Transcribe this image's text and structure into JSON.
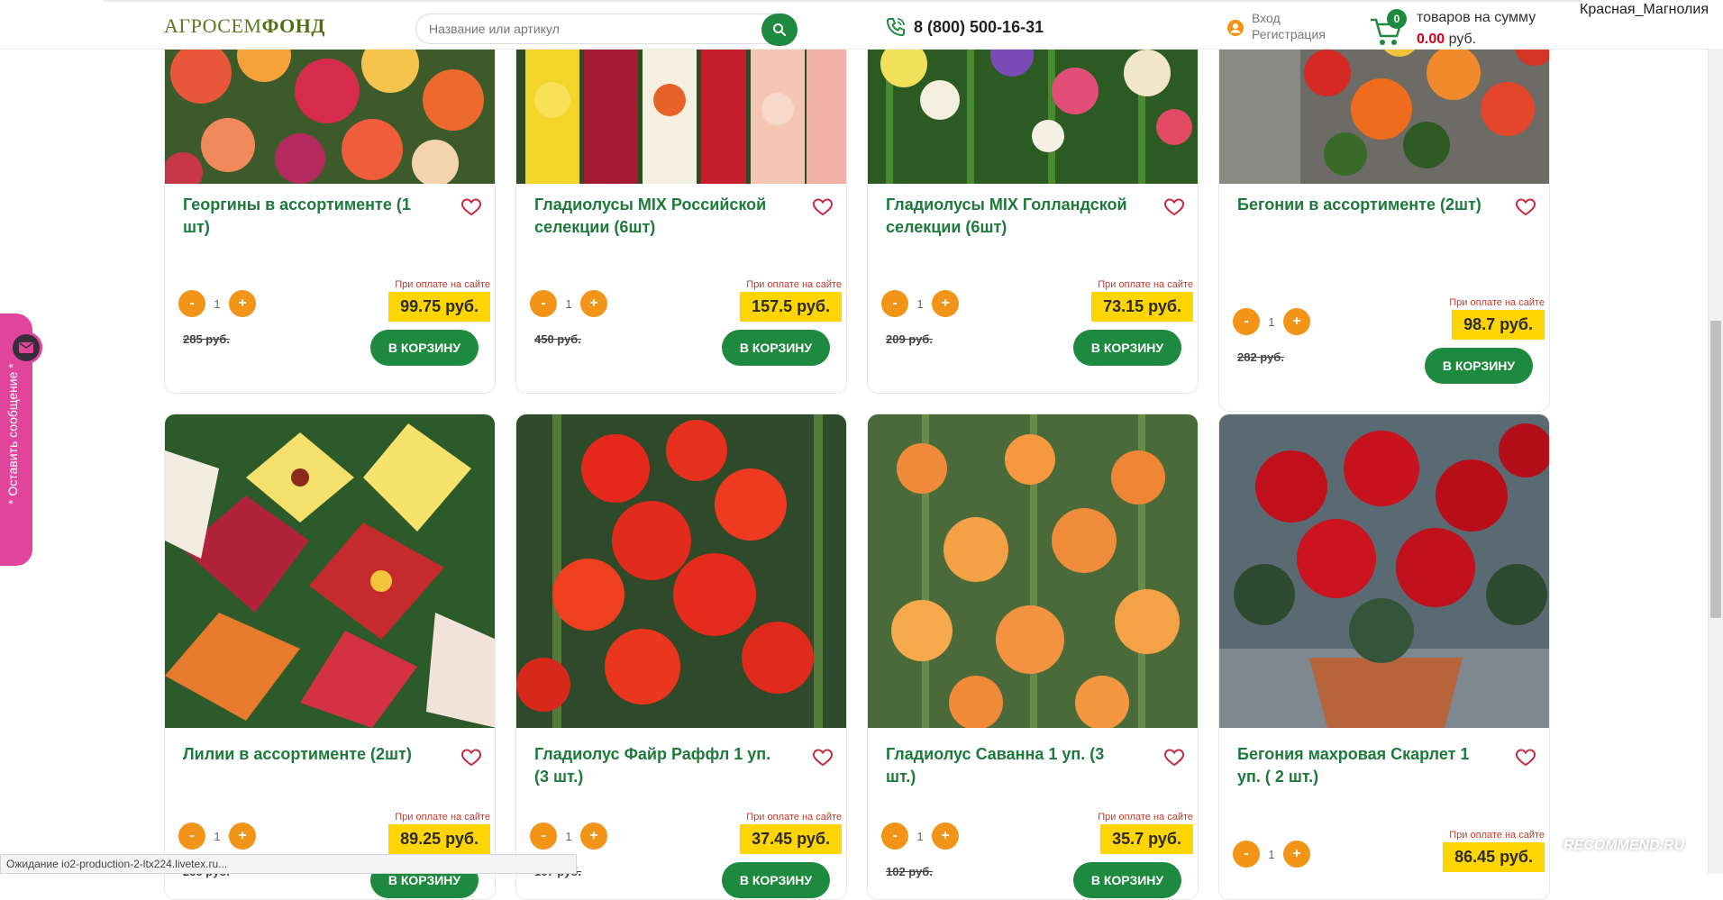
{
  "header": {
    "logo_part1": "АГРОСЕМ",
    "logo_part2": "ФОНД",
    "search_placeholder": "Название или артикул",
    "phone": "8 (800) 500-16-31",
    "login": "Вход",
    "register": "Регистрация",
    "cart_count": "0",
    "cart_text": "товаров на сумму",
    "cart_sum": "0.00",
    "cart_currency": "руб.",
    "username": "Красная_Магнолия"
  },
  "feedback": {
    "label": "* Оставить сообщение *"
  },
  "common": {
    "price_note": "При оплате на сайте",
    "add_to_cart": "В КОРЗИНУ",
    "minus": "-",
    "plus": "+"
  },
  "products_row1": [
    {
      "title": "Георгины в ассортименте (1 шт)",
      "qty": "1",
      "price": "99.75 руб.",
      "old_price": "285 руб."
    },
    {
      "title": "Гладиолусы MIX Российской селекции (6шт)",
      "qty": "1",
      "price": "157.5 руб.",
      "old_price": "450 руб."
    },
    {
      "title": "Гладиолусы MIX Голландской селекции (6шт)",
      "qty": "1",
      "price": "73.15 руб.",
      "old_price": "209 руб."
    },
    {
      "title": "Бегонии в ассортименте (2шт)",
      "qty": "1",
      "price": "98.7 руб.",
      "old_price": "282 руб."
    }
  ],
  "products_row2": [
    {
      "title": "Лилии в ассортименте (2шт)",
      "qty": "1",
      "price": "89.25 руб.",
      "old_price": "255 руб."
    },
    {
      "title": "Гладиолус Файр Раффл 1 уп. (3 шт.)",
      "qty": "1",
      "price": "37.45 руб.",
      "old_price": "107 руб."
    },
    {
      "title": "Гладиолус Саванна 1 уп. (3 шт.)",
      "qty": "1",
      "price": "35.7 руб.",
      "old_price": "102 руб."
    },
    {
      "title": "Бегония махровая Скарлет 1 уп. ( 2 шт.)",
      "qty": "1",
      "price": "86.45 руб.",
      "old_price": ""
    }
  ],
  "statusbar": {
    "text": "Ожидание io2-production-2-ltx224.livetex.ru..."
  },
  "watermark": "RECOMMEND.RU",
  "colors": {
    "accent_green": "#1e8a3f",
    "price_yellow": "#ffd500",
    "qty_orange": "#f29418",
    "feedback_pink": "#e0449b"
  }
}
